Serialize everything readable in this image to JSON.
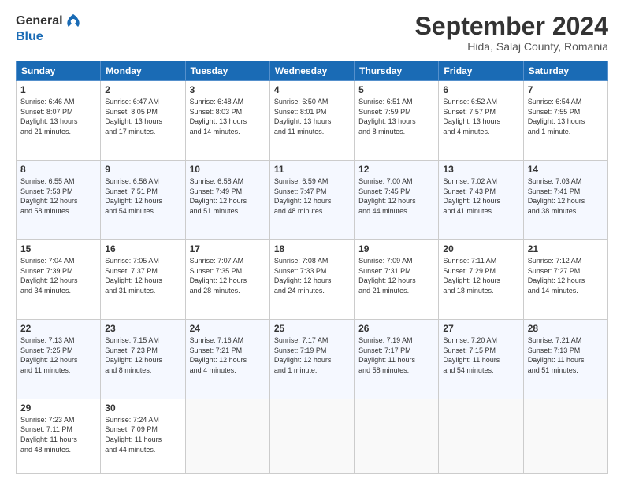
{
  "header": {
    "logo_line1": "General",
    "logo_line2": "Blue",
    "month": "September 2024",
    "location": "Hida, Salaj County, Romania"
  },
  "days_of_week": [
    "Sunday",
    "Monday",
    "Tuesday",
    "Wednesday",
    "Thursday",
    "Friday",
    "Saturday"
  ],
  "weeks": [
    [
      {
        "day": "1",
        "text": "Sunrise: 6:46 AM\nSunset: 8:07 PM\nDaylight: 13 hours\nand 21 minutes."
      },
      {
        "day": "2",
        "text": "Sunrise: 6:47 AM\nSunset: 8:05 PM\nDaylight: 13 hours\nand 17 minutes."
      },
      {
        "day": "3",
        "text": "Sunrise: 6:48 AM\nSunset: 8:03 PM\nDaylight: 13 hours\nand 14 minutes."
      },
      {
        "day": "4",
        "text": "Sunrise: 6:50 AM\nSunset: 8:01 PM\nDaylight: 13 hours\nand 11 minutes."
      },
      {
        "day": "5",
        "text": "Sunrise: 6:51 AM\nSunset: 7:59 PM\nDaylight: 13 hours\nand 8 minutes."
      },
      {
        "day": "6",
        "text": "Sunrise: 6:52 AM\nSunset: 7:57 PM\nDaylight: 13 hours\nand 4 minutes."
      },
      {
        "day": "7",
        "text": "Sunrise: 6:54 AM\nSunset: 7:55 PM\nDaylight: 13 hours\nand 1 minute."
      }
    ],
    [
      {
        "day": "8",
        "text": "Sunrise: 6:55 AM\nSunset: 7:53 PM\nDaylight: 12 hours\nand 58 minutes."
      },
      {
        "day": "9",
        "text": "Sunrise: 6:56 AM\nSunset: 7:51 PM\nDaylight: 12 hours\nand 54 minutes."
      },
      {
        "day": "10",
        "text": "Sunrise: 6:58 AM\nSunset: 7:49 PM\nDaylight: 12 hours\nand 51 minutes."
      },
      {
        "day": "11",
        "text": "Sunrise: 6:59 AM\nSunset: 7:47 PM\nDaylight: 12 hours\nand 48 minutes."
      },
      {
        "day": "12",
        "text": "Sunrise: 7:00 AM\nSunset: 7:45 PM\nDaylight: 12 hours\nand 44 minutes."
      },
      {
        "day": "13",
        "text": "Sunrise: 7:02 AM\nSunset: 7:43 PM\nDaylight: 12 hours\nand 41 minutes."
      },
      {
        "day": "14",
        "text": "Sunrise: 7:03 AM\nSunset: 7:41 PM\nDaylight: 12 hours\nand 38 minutes."
      }
    ],
    [
      {
        "day": "15",
        "text": "Sunrise: 7:04 AM\nSunset: 7:39 PM\nDaylight: 12 hours\nand 34 minutes."
      },
      {
        "day": "16",
        "text": "Sunrise: 7:05 AM\nSunset: 7:37 PM\nDaylight: 12 hours\nand 31 minutes."
      },
      {
        "day": "17",
        "text": "Sunrise: 7:07 AM\nSunset: 7:35 PM\nDaylight: 12 hours\nand 28 minutes."
      },
      {
        "day": "18",
        "text": "Sunrise: 7:08 AM\nSunset: 7:33 PM\nDaylight: 12 hours\nand 24 minutes."
      },
      {
        "day": "19",
        "text": "Sunrise: 7:09 AM\nSunset: 7:31 PM\nDaylight: 12 hours\nand 21 minutes."
      },
      {
        "day": "20",
        "text": "Sunrise: 7:11 AM\nSunset: 7:29 PM\nDaylight: 12 hours\nand 18 minutes."
      },
      {
        "day": "21",
        "text": "Sunrise: 7:12 AM\nSunset: 7:27 PM\nDaylight: 12 hours\nand 14 minutes."
      }
    ],
    [
      {
        "day": "22",
        "text": "Sunrise: 7:13 AM\nSunset: 7:25 PM\nDaylight: 12 hours\nand 11 minutes."
      },
      {
        "day": "23",
        "text": "Sunrise: 7:15 AM\nSunset: 7:23 PM\nDaylight: 12 hours\nand 8 minutes."
      },
      {
        "day": "24",
        "text": "Sunrise: 7:16 AM\nSunset: 7:21 PM\nDaylight: 12 hours\nand 4 minutes."
      },
      {
        "day": "25",
        "text": "Sunrise: 7:17 AM\nSunset: 7:19 PM\nDaylight: 12 hours\nand 1 minute."
      },
      {
        "day": "26",
        "text": "Sunrise: 7:19 AM\nSunset: 7:17 PM\nDaylight: 11 hours\nand 58 minutes."
      },
      {
        "day": "27",
        "text": "Sunrise: 7:20 AM\nSunset: 7:15 PM\nDaylight: 11 hours\nand 54 minutes."
      },
      {
        "day": "28",
        "text": "Sunrise: 7:21 AM\nSunset: 7:13 PM\nDaylight: 11 hours\nand 51 minutes."
      }
    ],
    [
      {
        "day": "29",
        "text": "Sunrise: 7:23 AM\nSunset: 7:11 PM\nDaylight: 11 hours\nand 48 minutes."
      },
      {
        "day": "30",
        "text": "Sunrise: 7:24 AM\nSunset: 7:09 PM\nDaylight: 11 hours\nand 44 minutes."
      },
      {
        "day": "",
        "text": ""
      },
      {
        "day": "",
        "text": ""
      },
      {
        "day": "",
        "text": ""
      },
      {
        "day": "",
        "text": ""
      },
      {
        "day": "",
        "text": ""
      }
    ]
  ]
}
